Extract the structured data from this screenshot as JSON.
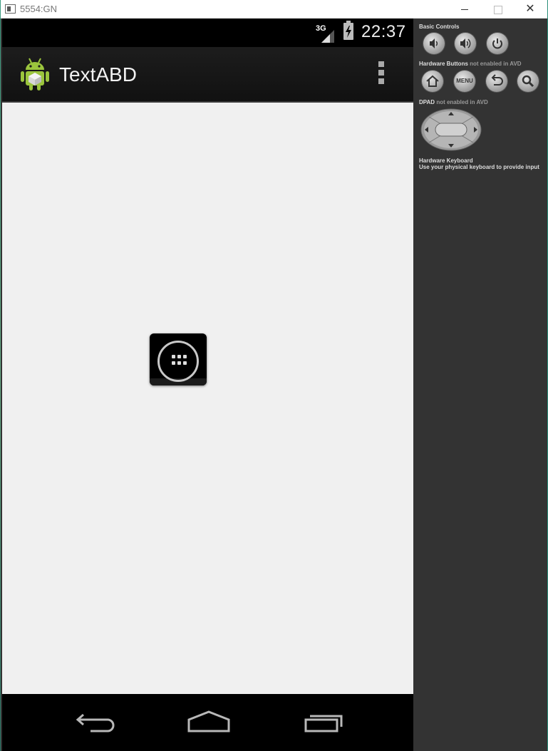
{
  "window": {
    "title": "5554:GN",
    "min_symbol": "",
    "max_symbol": "",
    "close_symbol": "✕"
  },
  "status_bar": {
    "network": "3G",
    "time": "22:37",
    "battery_icon": "battery-charging-icon"
  },
  "action_bar": {
    "app_title": "TextABD",
    "app_icon": "android-robot-icon",
    "menu_icon": "overflow-menu-icon"
  },
  "content": {
    "launcher_button": "app-drawer-icon"
  },
  "nav_bar": {
    "buttons": [
      "back-icon",
      "home-icon",
      "recent-apps-icon"
    ]
  },
  "side_panel": {
    "basic_controls_label": "Basic Controls",
    "hardware_buttons_label": "Hardware Buttons",
    "hardware_buttons_note": "not enabled in AVD",
    "menu_label": "MENU",
    "dpad_label": "DPAD",
    "dpad_note": "not enabled in AVD",
    "keyboard_label": "Hardware Keyboard",
    "keyboard_note": "Use your physical keyboard to provide input"
  }
}
